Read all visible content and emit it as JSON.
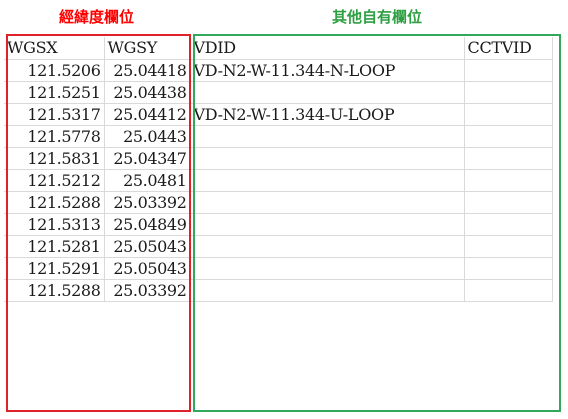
{
  "captions": {
    "coordinate_fields": "經緯度欄位",
    "other_fields": "其他自有欄位"
  },
  "colors": {
    "coordinate_caption": "#ff0000",
    "coordinate_border": "#e0202a",
    "other_caption": "#2ea043",
    "other_border": "#33a85a",
    "gridline": "#d9d9d9"
  },
  "table": {
    "headers": [
      "WGSX",
      "WGSY",
      "VDID",
      "CCTVID"
    ],
    "rows": [
      [
        "121.5206",
        "25.04418",
        "VD-N2-W-11.344-N-LOOP",
        ""
      ],
      [
        "121.5251",
        "25.04438",
        "",
        ""
      ],
      [
        "121.5317",
        "25.04412",
        "VD-N2-W-11.344-U-LOOP",
        ""
      ],
      [
        "121.5778",
        "25.0443",
        "",
        ""
      ],
      [
        "121.5831",
        "25.04347",
        "",
        ""
      ],
      [
        "121.5212",
        "25.0481",
        "",
        ""
      ],
      [
        "121.5288",
        "25.03392",
        "",
        ""
      ],
      [
        "121.5313",
        "25.04849",
        "",
        ""
      ],
      [
        "121.5281",
        "25.05043",
        "",
        ""
      ],
      [
        "121.5291",
        "25.05043",
        "",
        ""
      ],
      [
        "121.5288",
        "25.03392",
        "",
        ""
      ]
    ]
  }
}
